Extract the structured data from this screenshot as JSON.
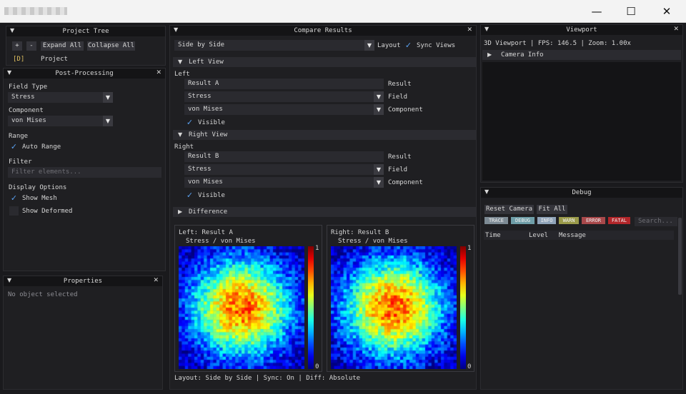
{
  "window": {
    "minimize": "—",
    "maximize": "☐",
    "close": "✕"
  },
  "project_tree": {
    "title": "Project Tree",
    "add": "+",
    "remove": "-",
    "expand_all": "Expand All",
    "collapse_all": "Collapse All",
    "root_tag": "[D]",
    "root_label": "Project"
  },
  "post_processing": {
    "title": "Post-Processing",
    "field_type_label": "Field Type",
    "field_type_value": "Stress",
    "component_label": "Component",
    "component_value": "von Mises",
    "range_label": "Range",
    "auto_range": "Auto Range",
    "filter_label": "Filter",
    "filter_placeholder": "Filter elements...",
    "display_options_label": "Display Options",
    "show_mesh": "Show Mesh",
    "show_deformed": "Show Deformed"
  },
  "properties": {
    "title": "Properties",
    "empty": "No object selected"
  },
  "compare": {
    "title": "Compare Results",
    "layout_value": "Side by Side",
    "layout_label": "Layout",
    "sync_views": "Sync Views",
    "left": {
      "header": "Left View",
      "label": "Left",
      "result": "Result A",
      "result_label": "Result",
      "field": "Stress",
      "field_label": "Field",
      "component": "von Mises",
      "component_label": "Component",
      "visible": "Visible"
    },
    "right": {
      "header": "Right View",
      "label": "Right",
      "result": "Result B",
      "result_label": "Result",
      "field": "Stress",
      "field_label": "Field",
      "component": "von Mises",
      "component_label": "Component",
      "visible": "Visible"
    },
    "difference": "Difference",
    "plot_left": {
      "title": "Left: Result A",
      "subtitle": "Stress / von Mises",
      "max": "1",
      "min": "0"
    },
    "plot_right": {
      "title": "Right: Result B",
      "subtitle": "Stress / von Mises",
      "max": "1",
      "min": "0"
    },
    "status": "Layout: Side by Side | Sync: On | Diff: Absolute"
  },
  "viewport": {
    "title": "Viewport",
    "info": "3D Viewport | FPS: 146.5 | Zoom: 1.00x",
    "camera_info": "Camera Info"
  },
  "debug": {
    "title": "Debug",
    "reset_camera": "Reset Camera",
    "fit_all": "Fit All",
    "levels": [
      {
        "label": "TRACE",
        "color": "#7d8a94"
      },
      {
        "label": "DEBUG",
        "color": "#6f9ea8"
      },
      {
        "label": "INFO",
        "color": "#8fa3b8"
      },
      {
        "label": "WARN",
        "color": "#9a9a4a"
      },
      {
        "label": "ERROR",
        "color": "#a8484a"
      },
      {
        "label": "FATAL",
        "color": "#b2262a"
      }
    ],
    "search_placeholder": "Search...",
    "col_time": "Time",
    "col_level": "Level",
    "col_message": "Message"
  },
  "colors": {
    "check": "#5aa0f0",
    "panel": "#1f1f22",
    "header": "#141416"
  }
}
